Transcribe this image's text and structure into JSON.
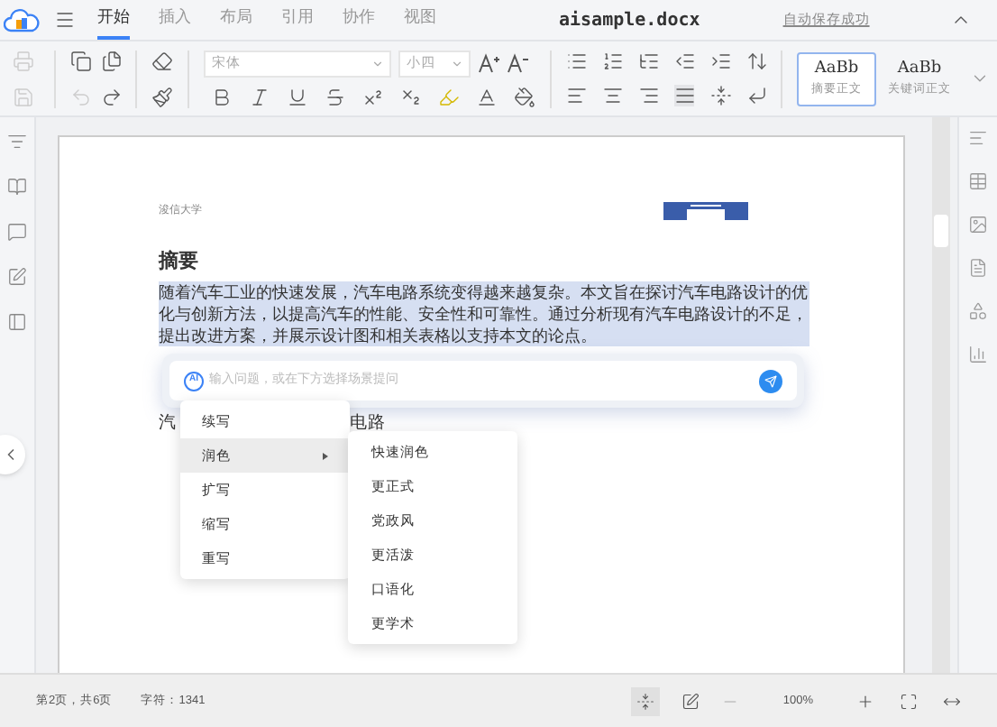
{
  "menu_tabs": [
    {
      "label": "开始",
      "selected": true
    },
    {
      "label": "插入",
      "selected": false
    },
    {
      "label": "布局",
      "selected": false
    },
    {
      "label": "引用",
      "selected": false
    },
    {
      "label": "协作",
      "selected": false
    },
    {
      "label": "视图",
      "selected": false
    }
  ],
  "file_name": "aisample.docx",
  "save_status": "自动保存成功",
  "toolbar": {
    "font": "宋体",
    "size": "小四",
    "styles": [
      {
        "preview": "AaBb",
        "name": "摘要正文",
        "selected": true
      },
      {
        "preview": "AaBb",
        "name": "关键词正文",
        "selected": false
      }
    ]
  },
  "document": {
    "header": "浚信大学",
    "heading": "摘要",
    "paragraph": "随着汽车工业的快速发展，汽车电路系统变得越来越复杂。本文旨在探讨汽车电路设计的优化与创新方法，以提高汽车的性能、安全性和可靠性。通过分析现有汽车电路设计的不足，提出改进方案，并展示设计图和相关表格以支持本文的论点。",
    "fragments": [
      "汽",
      "电路"
    ]
  },
  "ai_box": {
    "badge": "AI",
    "placeholder": "输入问题，或在下方选择场景提问"
  },
  "menu": [
    {
      "label": "续写",
      "selected": false,
      "submenu": false
    },
    {
      "label": "润色",
      "selected": true,
      "submenu": true
    },
    {
      "label": "扩写",
      "selected": false,
      "submenu": false
    },
    {
      "label": "缩写",
      "selected": false,
      "submenu": false
    },
    {
      "label": "重写",
      "selected": false,
      "submenu": false
    }
  ],
  "submenu": [
    "快速润色",
    "更正式",
    "党政风",
    "更活泼",
    "口语化",
    "更学术"
  ],
  "status": {
    "page": "第2页，共6页",
    "chars": "字符：1341",
    "zoom": "100%"
  }
}
